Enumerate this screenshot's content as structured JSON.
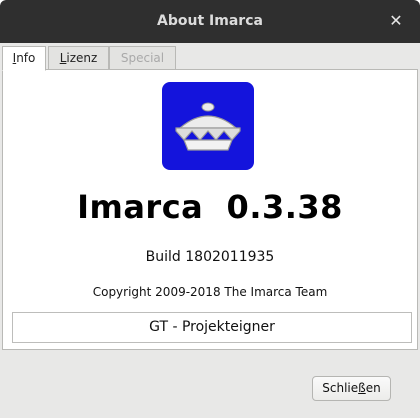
{
  "window": {
    "title": "About Imarca",
    "close_glyph": "✕"
  },
  "tabs": [
    {
      "label_prefix": "",
      "mnemonic": "I",
      "label_rest": "nfo",
      "state": "active"
    },
    {
      "label_prefix": "",
      "mnemonic": "L",
      "label_rest": "izenz",
      "state": "normal"
    },
    {
      "label_prefix": "Special",
      "mnemonic": "",
      "label_rest": "",
      "state": "disabled"
    }
  ],
  "info": {
    "logo_icon": "crown-logo-icon",
    "logo_color": "#1414dc",
    "app_name": "Imarca  0.3.38",
    "build": "Build 1802011935",
    "copyright": "Copyright 2009-2018  The Imarca Team",
    "owner": "GT - Projekteigner"
  },
  "footer": {
    "close_prefix": "Schlie",
    "close_mnemonic": "ß",
    "close_rest": "en"
  }
}
